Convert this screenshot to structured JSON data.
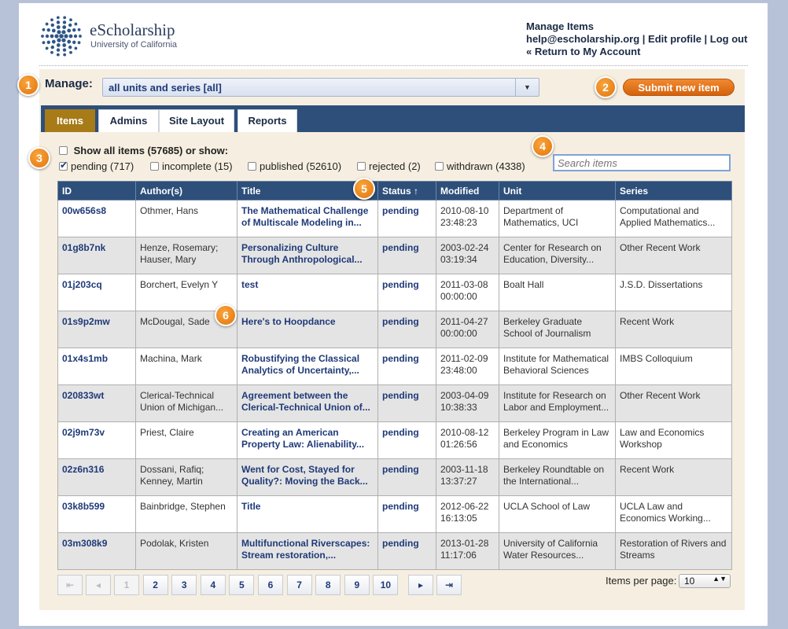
{
  "brand": {
    "name": "eScholarship",
    "sub": "University of California"
  },
  "header": {
    "title": "Manage Items",
    "email": "help@escholarship.org",
    "sep1": " | ",
    "edit_profile": "Edit profile",
    "sep2": "  | ",
    "logout": "Log out",
    "return": "« Return to My Account"
  },
  "manage": {
    "label": "Manage:",
    "value": "all units and series [all]"
  },
  "submit_label": "Submit new item",
  "tabs": [
    "Items",
    "Admins",
    "Site Layout",
    "Reports"
  ],
  "filters": {
    "show_all": "Show all items (57685) or show:",
    "options": [
      {
        "label": "pending (717)",
        "checked": true
      },
      {
        "label": "incomplete (15)",
        "checked": false
      },
      {
        "label": "published (52610)",
        "checked": false
      },
      {
        "label": "rejected (2)",
        "checked": false
      },
      {
        "label": "withdrawn (4338)",
        "checked": false
      }
    ]
  },
  "search": {
    "placeholder": "Search items"
  },
  "table": {
    "columns": [
      "ID",
      "Author(s)",
      "Title",
      "Status ↑",
      "Modified",
      "Unit",
      "Series"
    ],
    "rows": [
      [
        "00w656s8",
        "Othmer, Hans",
        "The Mathematical Challenge of Multiscale Modeling in...",
        "pending",
        "2010-08-10 23:48:23",
        "Department of Mathematics, UCI",
        "Computational and Applied Mathematics..."
      ],
      [
        "01g8b7nk",
        "Henze, Rosemary; Hauser, Mary",
        "Personalizing Culture Through Anthropological...",
        "pending",
        "2003-02-24 03:19:34",
        "Center for Research on Education, Diversity...",
        "Other Recent Work"
      ],
      [
        "01j203cq",
        "Borchert, Evelyn Y",
        "test",
        "pending",
        "2011-03-08 00:00:00",
        "Boalt Hall",
        "J.S.D. Dissertations"
      ],
      [
        "01s9p2mw",
        "McDougal, Sade",
        "Here's to Hoopdance",
        "pending",
        "2011-04-27 00:00:00",
        "Berkeley Graduate School of Journalism",
        "Recent Work"
      ],
      [
        "01x4s1mb",
        "Machina, Mark",
        "Robustifying the Classical Analytics of Uncertainty,...",
        "pending",
        "2011-02-09 23:48:00",
        "Institute for Mathematical Behavioral Sciences",
        "IMBS Colloquium"
      ],
      [
        "020833wt",
        "Clerical-Technical Union of Michigan...",
        "Agreement between the Clerical-Technical Union of...",
        "pending",
        "2003-04-09 10:38:33",
        "Institute for Research on Labor and Employment...",
        "Other Recent Work"
      ],
      [
        "02j9m73v",
        "Priest, Claire",
        "Creating an American Property Law: Alienability...",
        "pending",
        "2010-08-12 01:26:56",
        "Berkeley Program in Law and Economics",
        "Law and Economics Workshop"
      ],
      [
        "02z6n316",
        "Dossani, Rafiq; Kenney, Martin",
        "Went for Cost, Stayed for Quality?: Moving the Back...",
        "pending",
        "2003-11-18 13:37:27",
        "Berkeley Roundtable on the International...",
        "Recent Work"
      ],
      [
        "03k8b599",
        "Bainbridge, Stephen",
        "Title",
        "pending",
        "2012-06-22 16:13:05",
        "UCLA School of Law",
        "UCLA Law and Economics Working..."
      ],
      [
        "03m308k9",
        "Podolak, Kristen",
        "Multifunctional Riverscapes: Stream restoration,...",
        "pending",
        "2013-01-28 11:17:06",
        "University of California Water Resources...",
        "Restoration of Rivers and Streams"
      ]
    ]
  },
  "pager": {
    "first": "⇤",
    "prev": "◂",
    "pages": [
      "1",
      "2",
      "3",
      "4",
      "5",
      "6",
      "7",
      "8",
      "9",
      "10"
    ],
    "next": "▸",
    "last": "⇥"
  },
  "items_per_page": {
    "label": "Items per page:",
    "value": "10"
  },
  "badges": [
    "1",
    "2",
    "3",
    "4",
    "5",
    "6"
  ]
}
